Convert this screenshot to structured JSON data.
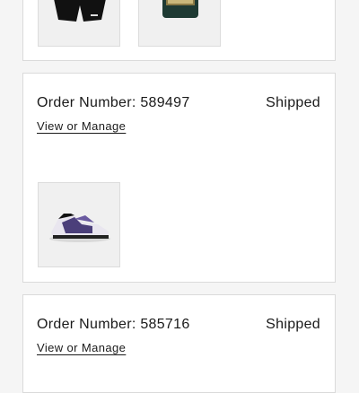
{
  "orders": [
    {
      "number_label": "",
      "status": "",
      "manage_label": "",
      "items": [
        {
          "icon": "black-shorts-image"
        },
        {
          "icon": "green-jar-image"
        }
      ]
    },
    {
      "number_label": "Order Number: 589497",
      "status": "Shipped",
      "manage_label": "View or Manage",
      "items": [
        {
          "icon": "sneaker-image"
        }
      ]
    },
    {
      "number_label": "Order Number: 585716",
      "status": "Shipped",
      "manage_label": "View or Manage",
      "items": []
    }
  ]
}
